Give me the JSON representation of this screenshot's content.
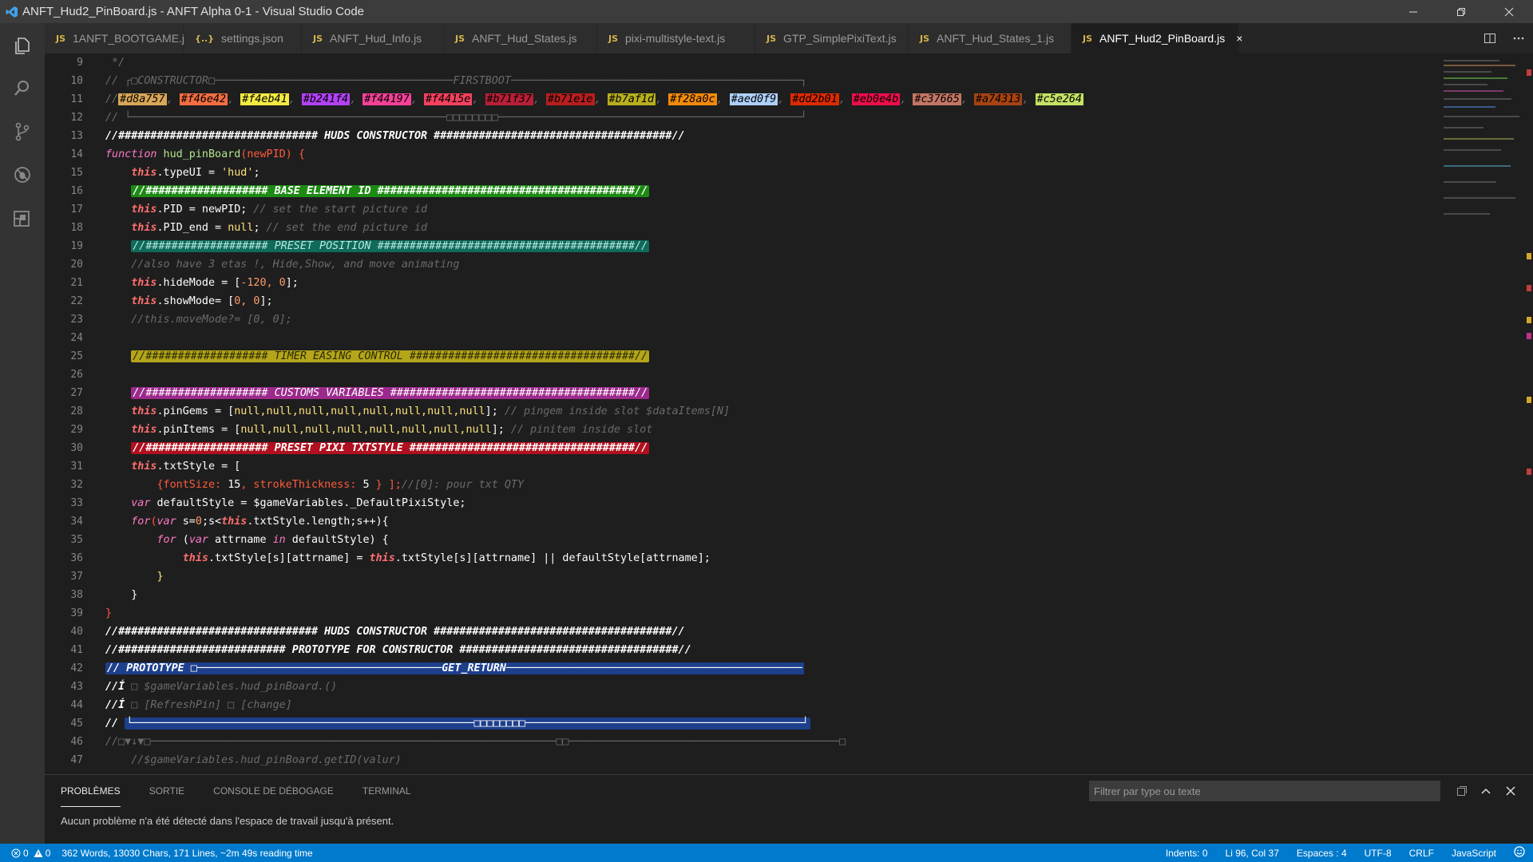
{
  "window": {
    "title": "ANFT_Hud2_PinBoard.js - ANFT Alpha 0-1 - Visual Studio Code",
    "controls": [
      "minimize-icon",
      "restore-icon",
      "close-icon"
    ]
  },
  "activity_bar": {
    "icons": [
      "explorer-icon",
      "search-icon",
      "source-control-icon",
      "debug-icon",
      "extensions-icon"
    ]
  },
  "tabs": [
    {
      "label": "1ANFT_BOOTGAME.js",
      "icon": "JS",
      "active": false
    },
    {
      "label": "settings.json",
      "icon": "{..}",
      "active": false
    },
    {
      "label": "ANFT_Hud_Info.js",
      "icon": "JS",
      "active": false
    },
    {
      "label": "ANFT_Hud_States.js",
      "icon": "JS",
      "active": false
    },
    {
      "label": "pixi-multistyle-text.js",
      "icon": "JS",
      "active": false
    },
    {
      "label": "GTP_SimplePixiText.js",
      "icon": "JS",
      "active": false
    },
    {
      "label": "ANFT_Hud_States_1.js",
      "icon": "JS",
      "active": false
    },
    {
      "label": "ANFT_Hud2_PinBoard.js",
      "icon": "JS",
      "active": true
    }
  ],
  "tab_close": "×",
  "editor": {
    "line_numbers": [
      "9",
      "10",
      "11",
      "12",
      "13",
      "14",
      "15",
      "16",
      "17",
      "18",
      "19",
      "20",
      "21",
      "22",
      "23",
      "24",
      "25",
      "26",
      "27",
      "28",
      "29",
      "30",
      "31",
      "32",
      "33",
      "34",
      "35",
      "36",
      "37",
      "38",
      "39",
      "40",
      "41",
      "42",
      "43",
      "44",
      "45",
      "46",
      "47"
    ],
    "swatches": [
      "#d8a757",
      "#f46e42",
      "#f4eb41",
      "#b241f4",
      "#f44197",
      "#f4415e",
      "#b71f37",
      "#b71e1e",
      "#b7af1d",
      "#f28a0c",
      "#aed0f9",
      "#dd2b01",
      "#eb0e4b",
      "#c37665",
      "#a74313",
      "#c5e264"
    ],
    "lines": {
      "l9": " */",
      "l10a": "// ┌□CONSTRUCTOR□─────────────────────────────────────FIRSTBOOT─────────────────────────────────────────────┐",
      "l11a": "//",
      "l12": "// └─────────────────────────────────────────────────□□□□□□□□───────────────────────────────────────────────┘",
      "l13": "//############################### HUDS CONSTRUCTOR #####################################//",
      "l14_kw": "function",
      "l14_fn": " hud_pinBoard",
      "l14_rest": "(newPID) {",
      "l15_this": "this",
      "l15_rest": ".typeUI = ",
      "l15_str": "'hud'",
      "l15_end": ";",
      "l16": "//################### BASE ELEMENT ID ########################################//",
      "l17_this": "this",
      "l17_rest": ".PID = newPID;",
      "l17_cmt": " // set the start picture id",
      "l18_this": "this",
      "l18_rest": ".PID_end = ",
      "l18_null": "null",
      "l18_end": ";",
      "l18_cmt": " // set the end picture id",
      "l19": "//################### PRESET POSITION ########################################//",
      "l20": "//also have 3 etas !, Hide,Show, and move animating",
      "l21_this": "this",
      "l21_rest": ".hideMode = [",
      "l21_num": "-120, 0",
      "l21_end": "];",
      "l22_this": "this",
      "l22_rest": ".showMode= [",
      "l22_num": "0, 0",
      "l22_end": "];",
      "l23": "//this.moveMode?= [0, 0];",
      "l25": "//################### TIMER EASING CONTROL ###################################//",
      "l27": "//################### CUSTOMS VARIABLES ######################################//",
      "l28_this": "this",
      "l28_rest": ".pinGems = [",
      "l28_vals": "null,null,null,null,null,null,null,null",
      "l28_end": "];",
      "l28_cmt": " // pingem inside slot $dataItems[N]",
      "l29_this": "this",
      "l29_rest": ".pinItems = [",
      "l29_vals": "null,null,null,null,null,null,null,null",
      "l29_end": "];",
      "l29_cmt": " // pinitem inside slot",
      "l30": "//################### PRESET PIXI TXTSTYLE ###################################//",
      "l31_this": "this",
      "l31_rest": ".txtStyle = [",
      "l32_a": "{fontSize: ",
      "l32_n1": "15",
      "l32_b": ", strokeThickness: ",
      "l32_n2": "5",
      "l32_c": " } ];",
      "l32_cmt": "//[0]: pour txt QTY",
      "l33_kw": "var",
      "l33_rest": " defaultStyle = $gameVariables._DefaultPixiStyle;",
      "l34_kw": "for",
      "l34_a": "(",
      "l34_kw2": "var",
      "l34_b": " s=",
      "l34_n": "0",
      "l34_c": ";s<",
      "l34_this": "this",
      "l34_d": ".txtStyle.length;s++){",
      "l35_kw": "for",
      "l35_a": " (",
      "l35_kw2": "var",
      "l35_b": " attrname ",
      "l35_kw3": "in",
      "l35_c": " defaultStyle) {",
      "l36_this": "this",
      "l36_a": ".txtStyle[s][attrname] = ",
      "l36_this2": "this",
      "l36_b": ".txtStyle[s][attrname] || defaultStyle[attrname];",
      "l37": "}",
      "l38": "}",
      "l39": "}",
      "l40": "//############################### HUDS CONSTRUCTOR #####################################//",
      "l41": "//########################## PROTOTYPE FOR CONSTRUCTOR ##################################//",
      "l42": "// PROTOTYPE □──────────────────────────────────────GET_RETURN──────────────────────────────────────────────",
      "l43_a": "//Í ",
      "l43_b": "□ $gameVariables.hud_pinBoard.()",
      "l44_a": "//Í ",
      "l44_b": "□ [RefreshPin] □ [change]",
      "l45_a": "// ",
      "l45_b": "└─────────────────────────────────────────────────────□□□□□□□□───────────────────────────────────────────┘",
      "l46": "//□▼↓▼□───────────────────────────────────────────────────────────────□□──────────────────────────────────────────□",
      "l47": "//$gameVariables.hud_pinBoard.getID(valur)"
    }
  },
  "panel": {
    "tabs": [
      "PROBLÈMES",
      "SORTIE",
      "CONSOLE DE DÉBOGAGE",
      "TERMINAL"
    ],
    "filter_placeholder": "Filtrer par type ou texte",
    "message": "Aucun problème n'a été détecté dans l'espace de travail jusqu'à présent."
  },
  "status": {
    "errors": "0",
    "warnings": "0",
    "stats": "362 Words, 13030 Chars, 171 Lines, ~2m 49s reading time",
    "indents": "Indents: 0",
    "position": "Li 96, Col 37",
    "spaces": "Espaces : 4",
    "encoding": "UTF-8",
    "eol": "CRLF",
    "language": "JavaScript"
  },
  "colors": {
    "accent": "#007acc",
    "banner_green": "#1d8a14",
    "banner_teal": "#0f6a5a",
    "banner_yellow": "#b4a51a",
    "banner_magenta": "#9c2a8c",
    "banner_red": "#b0101f",
    "banner_blue": "#1d3f8c"
  }
}
